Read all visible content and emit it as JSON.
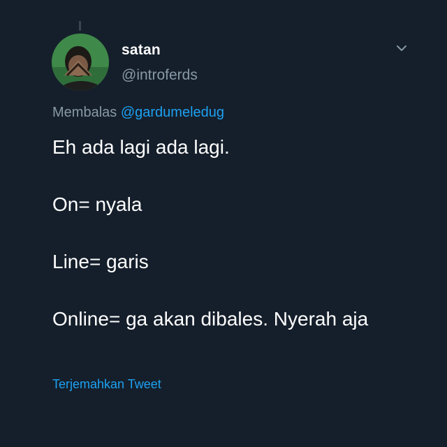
{
  "tweet": {
    "display_name": "satan",
    "handle": "@introferds",
    "reply_prefix": "Membalas",
    "reply_mention": "@gardumeledug",
    "lines": [
      "Eh ada lagi ada lagi.",
      "On= nyala",
      "Line= garis",
      "Online= ga akan dibales. Nyerah aja"
    ],
    "translate_label": "Terjemahkan Tweet"
  },
  "colors": {
    "background": "#151f2b",
    "primary_text": "#ffffff",
    "secondary_text": "#8899a6",
    "link": "#1da1f2"
  },
  "icons": {
    "menu": "chevron-down-icon",
    "avatar": "avatar"
  }
}
